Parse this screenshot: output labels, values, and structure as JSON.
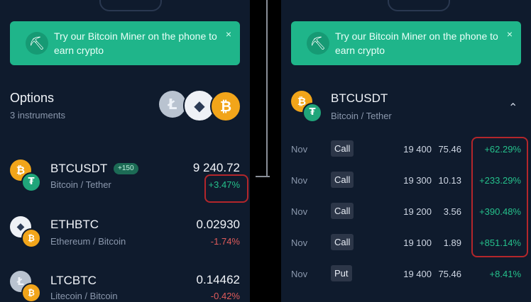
{
  "banner": {
    "text": "Try our Bitcoin Miner on the phone to earn crypto",
    "close": "×"
  },
  "left": {
    "title": "Options",
    "subtitle": "3 instruments",
    "rows": [
      {
        "symbol": "BTCUSDT",
        "badge": "+150",
        "name": "Bitcoin / Tether",
        "price": "9 240.72",
        "change": "+3.47%"
      },
      {
        "symbol": "ETHBTC",
        "name": "Ethereum / Bitcoin",
        "price": "0.02930",
        "change": "-1.74%"
      },
      {
        "symbol": "LTCBTC",
        "name": "Litecoin / Bitcoin",
        "price": "0.14462",
        "change": "-0.42%"
      }
    ]
  },
  "right": {
    "symbol": "BTCUSDT",
    "name": "Bitcoin / Tether",
    "chevron": "⌃",
    "options": [
      {
        "month": "Nov",
        "type": "Call",
        "strike": "19 400",
        "premium": "75.46",
        "change": "+62.29%"
      },
      {
        "month": "Nov",
        "type": "Call",
        "strike": "19 300",
        "premium": "10.13",
        "change": "+233.29%"
      },
      {
        "month": "Nov",
        "type": "Call",
        "strike": "19 200",
        "premium": "3.56",
        "change": "+390.48%"
      },
      {
        "month": "Nov",
        "type": "Call",
        "strike": "19 100",
        "premium": "1.89",
        "change": "+851.14%"
      },
      {
        "month": "Nov",
        "type": "Put",
        "strike": "19 400",
        "premium": "75.46",
        "change": "+8.41%"
      }
    ]
  },
  "colors": {
    "bg": "#0f1b2d",
    "accent": "#1fb58a",
    "positive": "#25c08b",
    "negative": "#e05b5b",
    "highlight": "#b3262b"
  },
  "icons": {
    "banner": "pickaxe-icon",
    "btc": "bitcoin-icon",
    "eth": "ethereum-icon",
    "ltc": "litecoin-icon",
    "tether": "tether-icon"
  }
}
